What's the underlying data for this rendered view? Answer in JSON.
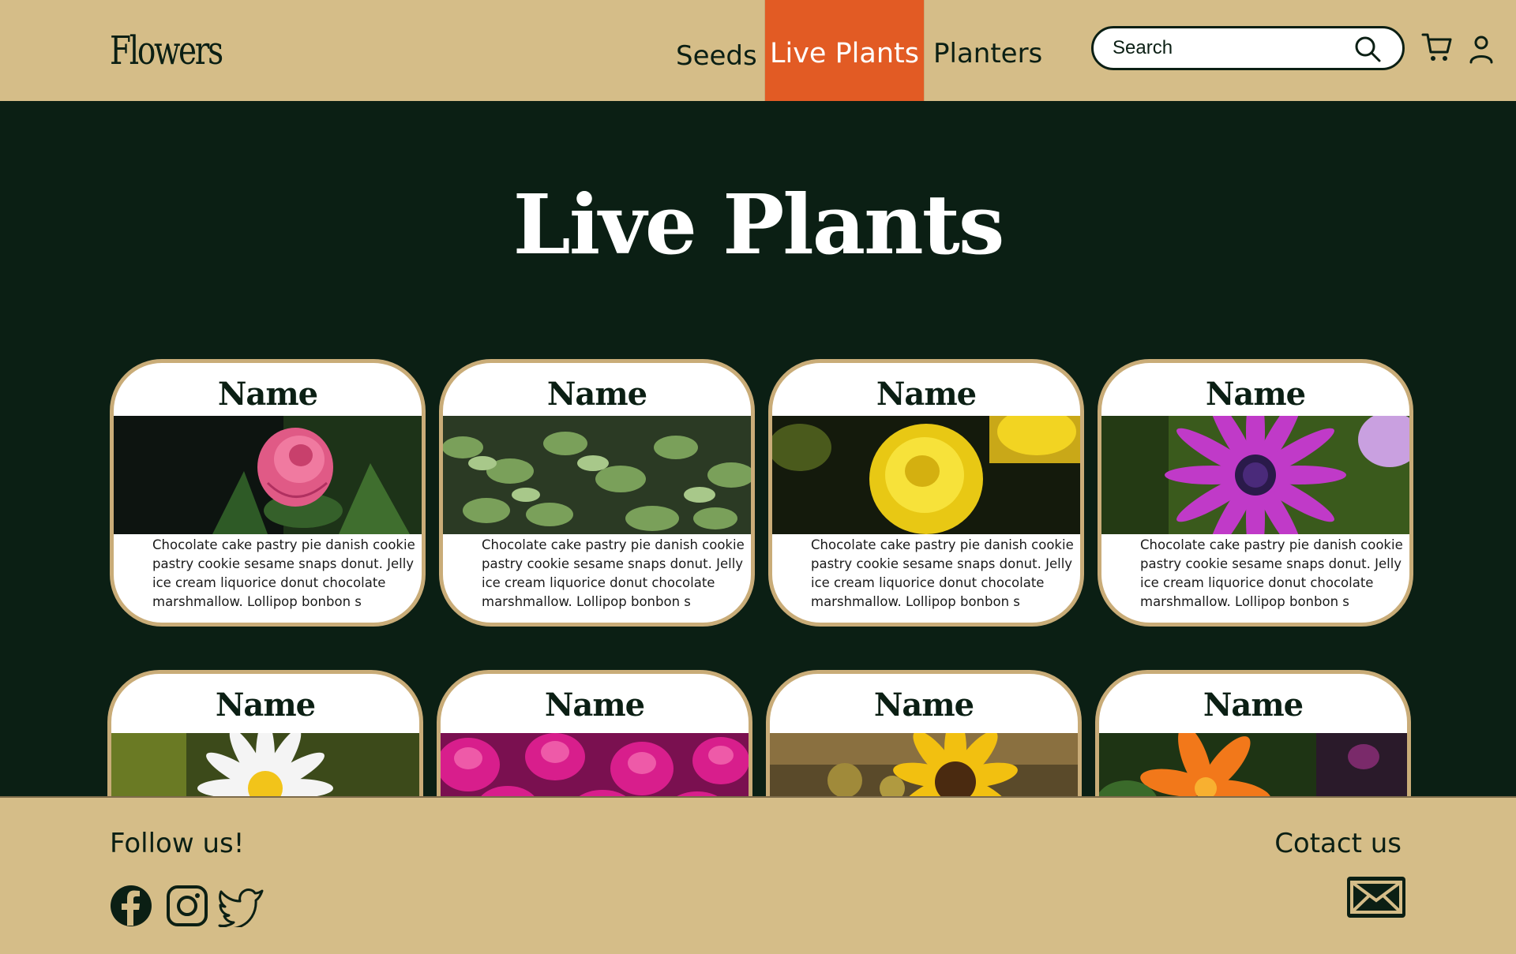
{
  "header": {
    "logo": "Flowers",
    "nav": [
      {
        "label": "Seeds"
      },
      {
        "label": "Live Plants",
        "active": true
      },
      {
        "label": "Planters"
      }
    ],
    "search_placeholder": "Search",
    "icons": [
      "search-icon",
      "cart-icon",
      "user-icon"
    ]
  },
  "main": {
    "title": "Live Plants",
    "cards": [
      {
        "name": "Name",
        "image": "pink-rose",
        "description": "Chocolate cake pastry pie danish cookie  pastry cookie sesame snaps donut. Jelly ice cream liquorice donut chocolate marshmallow. Lollipop bonbon s"
      },
      {
        "name": "Name",
        "image": "green-leaves",
        "description": "Chocolate cake pastry pie danish cookie  pastry cookie sesame snaps donut. Jelly ice cream liquorice donut chocolate marshmallow. Lollipop bonbon s"
      },
      {
        "name": "Name",
        "image": "yellow-marigold",
        "description": "Chocolate cake pastry pie danish cookie  pastry cookie sesame snaps donut. Jelly ice cream liquorice donut chocolate marshmallow. Lollipop bonbon s"
      },
      {
        "name": "Name",
        "image": "purple-daisy",
        "description": "Chocolate cake pastry pie danish cookie  pastry cookie sesame snaps donut. Jelly ice cream liquorice donut chocolate marshmallow. Lollipop bonbon s"
      },
      {
        "name": "Name",
        "image": "white-daisy"
      },
      {
        "name": "Name",
        "image": "pink-tulips"
      },
      {
        "name": "Name",
        "image": "sunflower"
      },
      {
        "name": "Name",
        "image": "orange-lily"
      }
    ]
  },
  "footer": {
    "follow_label": "Follow us!",
    "contact_label": "Cotact us",
    "social": [
      "facebook-icon",
      "instagram-icon",
      "twitter-icon"
    ],
    "contact_icon": "mail-icon"
  },
  "colors": {
    "header_bg": "#d5bd88",
    "main_bg": "#0b1f14",
    "accent": "#e25b24",
    "card_border": "#c9ac78"
  }
}
